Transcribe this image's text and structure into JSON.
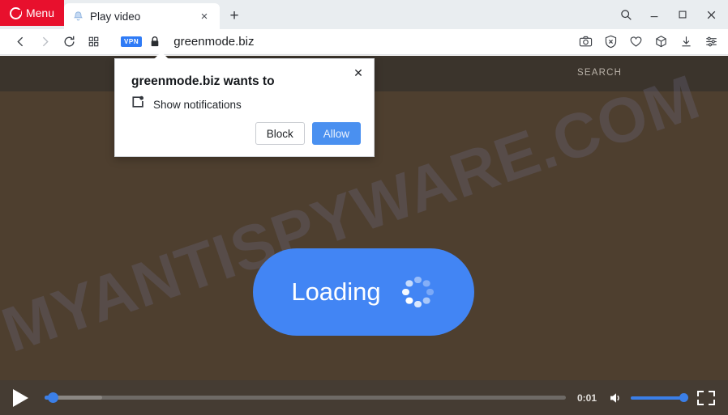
{
  "browser": {
    "menu_label": "Menu",
    "tab": {
      "title": "Play video",
      "favicon": "bell-favicon",
      "close_label": "×"
    },
    "new_tab_label": "+",
    "window_controls": {
      "search": "search-icon",
      "minimize": "—",
      "maximize": "□",
      "close": "×"
    },
    "nav": {
      "back": "‹",
      "forward": "›",
      "reload": "reload-icon",
      "speeddial": "grid-icon"
    },
    "address": {
      "vpn_badge": "VPN",
      "lock": "padlock-icon",
      "url": "greenmode.biz"
    },
    "toolbar_icons": [
      "snapshot-camera-icon",
      "adblock-shield-icon",
      "heart-icon",
      "extensions-cube-icon",
      "downloads-icon",
      "easy-setup-sliders-icon"
    ]
  },
  "page": {
    "site_header": {
      "search_label": "SEARCH"
    },
    "watermark": "MYANTISPYWARE.COM",
    "loading_button": {
      "label": "Loading",
      "spinner": "loading-spinner"
    },
    "background_color": "#4e3f2f",
    "header_color": "#3b342c",
    "accent_color": "#4285f4"
  },
  "video_controls": {
    "play_label": "play-icon",
    "current_time": "0:01",
    "progress_percent": 1.6,
    "buffered_percent": 11,
    "volume_percent": 100,
    "mute_label": "volume-icon",
    "fullscreen_label": "fullscreen-icon"
  },
  "permission_dialog": {
    "title": "greenmode.biz wants to",
    "permission_label": "Show notifications",
    "permission_icon": "notification-icon",
    "close_label": "✕",
    "block_label": "Block",
    "allow_label": "Allow",
    "allow_color": "#4a90f0"
  }
}
